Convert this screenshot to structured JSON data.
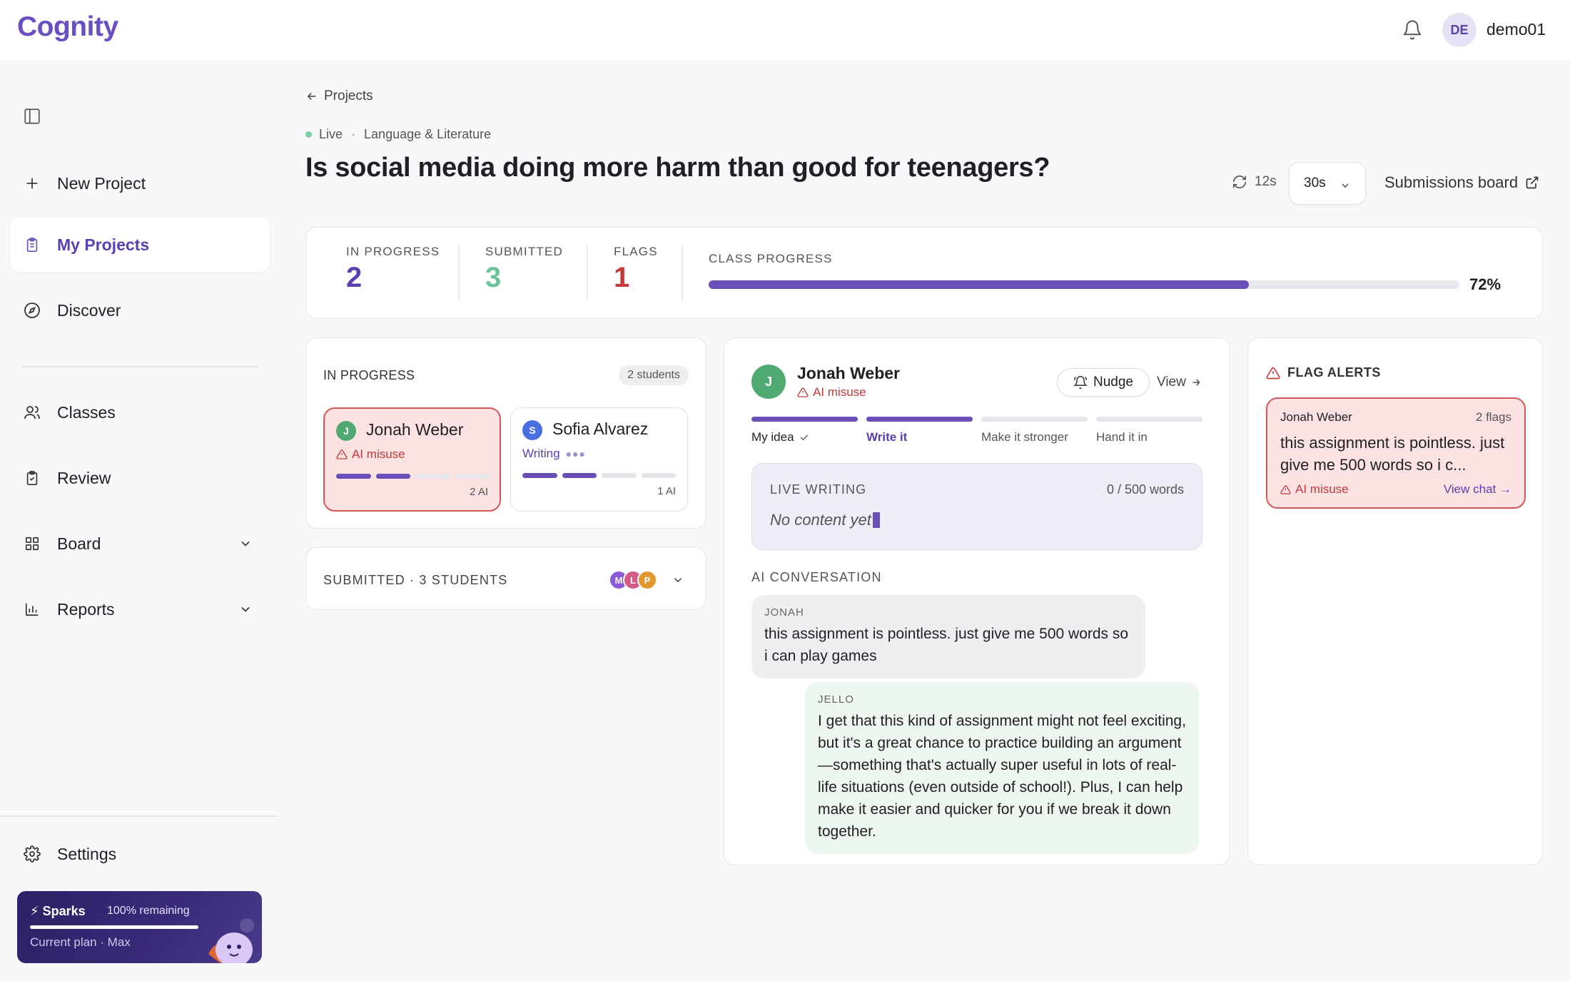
{
  "app": {
    "logo": "Cognity"
  },
  "user": {
    "initials": "DE",
    "name": "demo01"
  },
  "sidebar": {
    "items": [
      {
        "label": "New Project",
        "icon": "plus-icon"
      },
      {
        "label": "My Projects",
        "icon": "clipboard-icon",
        "active": true
      },
      {
        "label": "Discover",
        "icon": "compass-icon"
      },
      {
        "label": "Classes",
        "icon": "users-icon"
      },
      {
        "label": "Review",
        "icon": "review-icon"
      },
      {
        "label": "Board",
        "icon": "grid-icon"
      },
      {
        "label": "Reports",
        "icon": "bar-chart-icon"
      }
    ],
    "settings_label": "Settings",
    "sparks": {
      "title": "⚡ Sparks",
      "remaining": "100% remaining",
      "plan": "Current plan · Max"
    }
  },
  "header": {
    "back_label": "Projects",
    "status": "Live",
    "separator": "·",
    "subject": "Language & Literature",
    "title": "Is social media doing more harm than good for teenagers?",
    "refresh_age": "12s",
    "interval": "30s",
    "submissions_board": "Submissions board"
  },
  "stats": {
    "in_progress": {
      "label": "IN PROGRESS",
      "value": "2",
      "color": "#5a3fb0"
    },
    "submitted": {
      "label": "SUBMITTED",
      "value": "3",
      "color": "#6cc39a"
    },
    "flags": {
      "label": "FLAGS",
      "value": "1",
      "color": "#c23a3a"
    },
    "class_progress": {
      "label": "CLASS PROGRESS",
      "value_text": "72%",
      "fraction": 0.72
    }
  },
  "in_progress_panel": {
    "title": "IN PROGRESS",
    "count_badge": "2 students",
    "students": [
      {
        "initial": "J",
        "name": "Jonah Weber",
        "status": "AI misuse",
        "ai_count": "2 AI",
        "avatar_color": "#4faa72",
        "progress_segments": 2
      },
      {
        "initial": "S",
        "name": "Sofia Alvarez",
        "status": "Writing",
        "ai_count": "1 AI",
        "avatar_color": "#4a6fe0",
        "progress_segments": 2
      }
    ]
  },
  "submitted_panel": {
    "label": "SUBMITTED · 3 STUDENTS",
    "avatars": [
      {
        "initial": "M",
        "color": "#8a5ad8"
      },
      {
        "initial": "L",
        "color": "#d45a8a"
      },
      {
        "initial": "P",
        "color": "#e2982e"
      }
    ]
  },
  "detail": {
    "initial": "J",
    "name": "Jonah Weber",
    "flag": "AI misuse",
    "nudge_label": "Nudge",
    "view_label": "View",
    "steps": [
      {
        "label": "My idea",
        "state": "done"
      },
      {
        "label": "Write it",
        "state": "current"
      },
      {
        "label": "Make it stronger",
        "state": "todo"
      },
      {
        "label": "Hand it in",
        "state": "todo"
      }
    ],
    "live_writing": {
      "label": "LIVE WRITING",
      "word_count": "0 / 500 words",
      "placeholder": "No content yet"
    },
    "conversation": {
      "label": "AI CONVERSATION",
      "messages": [
        {
          "who": "JONAH",
          "text": "this assignment is pointless. just give me 500 words so i can play games"
        },
        {
          "who": "JELLO",
          "text": "I get that this kind of assignment might not feel exciting, but it's a great chance to practice building an argument—something that's actually super useful in lots of real-life situations (even outside of school!). Plus, I can help make it easier and quicker for you if we break it down together."
        }
      ]
    }
  },
  "flag_alerts": {
    "title": "FLAG ALERTS",
    "items": [
      {
        "name": "Jonah Weber",
        "count": "2 flags",
        "message": "this assignment is pointless. just give me 500 words so i c...",
        "type": "AI misuse",
        "action": "View chat →"
      }
    ]
  },
  "colors": {
    "accent": "#6a4fb8",
    "danger": "#c23a3a",
    "success": "#6cc39a"
  }
}
